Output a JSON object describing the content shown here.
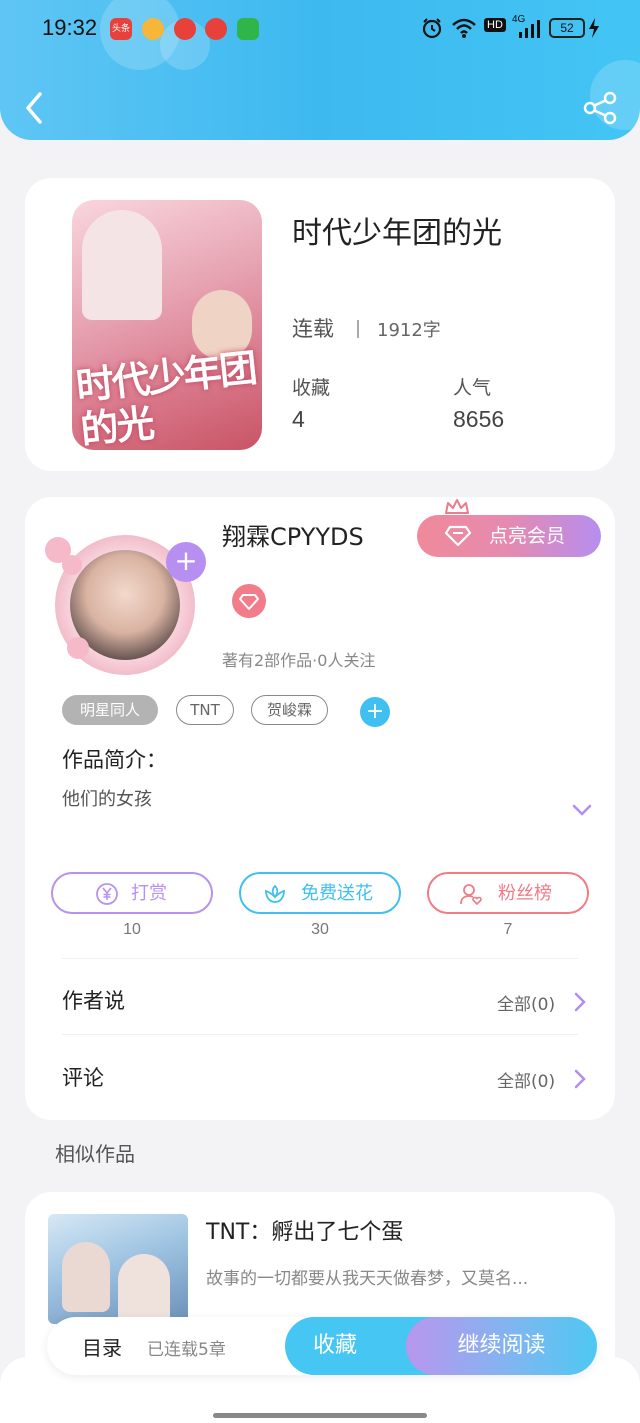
{
  "status_bar": {
    "time": "19:32",
    "app_icons": [
      "toutiao-icon",
      "weibo-icon",
      "app-icon",
      "video-icon",
      "game-icon"
    ],
    "app_icon_label": "头条",
    "signal": "4G",
    "hd": "HD",
    "battery": "52"
  },
  "header": {
    "colors": {
      "accent": "#3db9f0",
      "vip_start": "#f08a9a",
      "vip_end": "#b68ef0"
    }
  },
  "book": {
    "title": "时代少年团的光",
    "cover_title": "时代少年团的光",
    "status": "连载",
    "word_count": "1912字",
    "favorites_label": "收藏",
    "favorites_value": "4",
    "popularity_label": "人气",
    "popularity_value": "8656"
  },
  "author": {
    "name": "翔霖CPYYDS",
    "vip_button": "点亮会员",
    "meta": "著有2部作品·0人关注",
    "follow_symbol": "+"
  },
  "tags": [
    "明星同人",
    "TNT",
    "贺峻霖"
  ],
  "add_tag_symbol": "+",
  "intro": {
    "label": "作品简介：",
    "text": "他们的女孩"
  },
  "actions": [
    {
      "label": "打赏",
      "count": "10",
      "color": "#b892ec"
    },
    {
      "label": "免费送花",
      "count": "30",
      "color": "#3fc0f0"
    },
    {
      "label": "粉丝榜",
      "count": "7",
      "color": "#f07c86"
    }
  ],
  "rows": {
    "author_says": {
      "label": "作者说",
      "link": "全部(0)"
    },
    "comments": {
      "label": "评论",
      "link": "全部(0)"
    }
  },
  "similar": {
    "section_title": "相似作品",
    "items": [
      {
        "title": "TNT：孵出了七个蛋",
        "desc": "故事的一切都要从我天天做春梦，又莫名..."
      }
    ]
  },
  "bottom_bar": {
    "toc": "目录",
    "chapters": "已连载5章",
    "favorite": "收藏",
    "continue": "继续阅读"
  }
}
